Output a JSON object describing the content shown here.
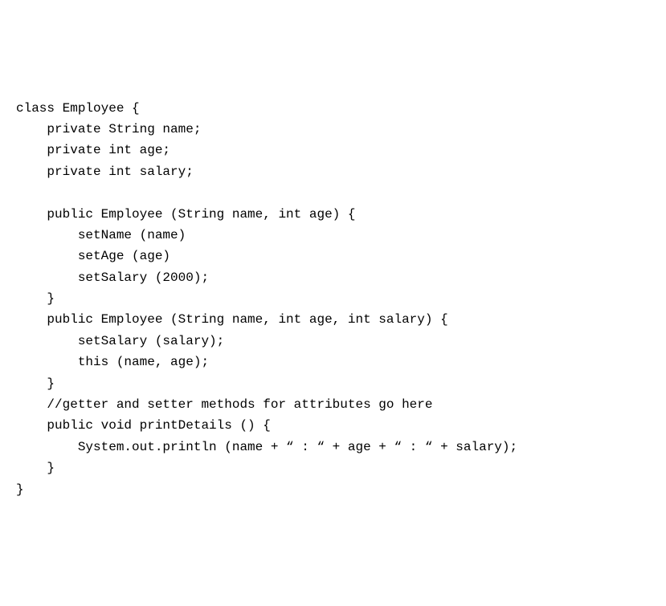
{
  "code": {
    "lines": [
      "class Employee {",
      "    private String name;",
      "    private int age;",
      "    private int salary;",
      "",
      "    public Employee (String name, int age) {",
      "        setName (name)",
      "        setAge (age)",
      "        setSalary (2000);",
      "    }",
      "    public Employee (String name, int age, int salary) {",
      "        setSalary (salary);",
      "        this (name, age);",
      "    }",
      "    //getter and setter methods for attributes go here",
      "    public void printDetails () {",
      "        System.out.println (name + “ : “ + age + “ : “ + salary);",
      "    }",
      "}"
    ]
  }
}
